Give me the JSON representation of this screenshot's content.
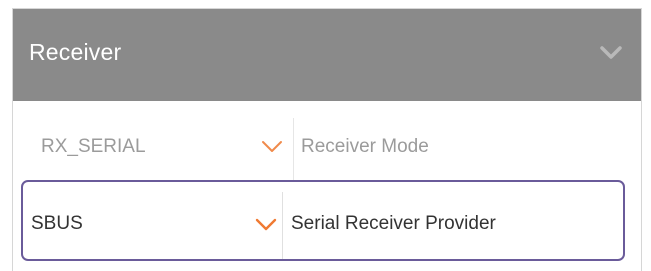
{
  "panel": {
    "title": "Receiver",
    "collapse_icon": "chevron-down-icon",
    "header_color": "#8a8a8a"
  },
  "rows": [
    {
      "value": "RX_SERIAL",
      "label": "Receiver Mode",
      "chevron_color": "#f08a4b"
    },
    {
      "value": "SBUS",
      "label": "Serial Receiver Provider",
      "chevron_color": "#f07a32",
      "highlight_color": "#6a5b9a"
    }
  ]
}
